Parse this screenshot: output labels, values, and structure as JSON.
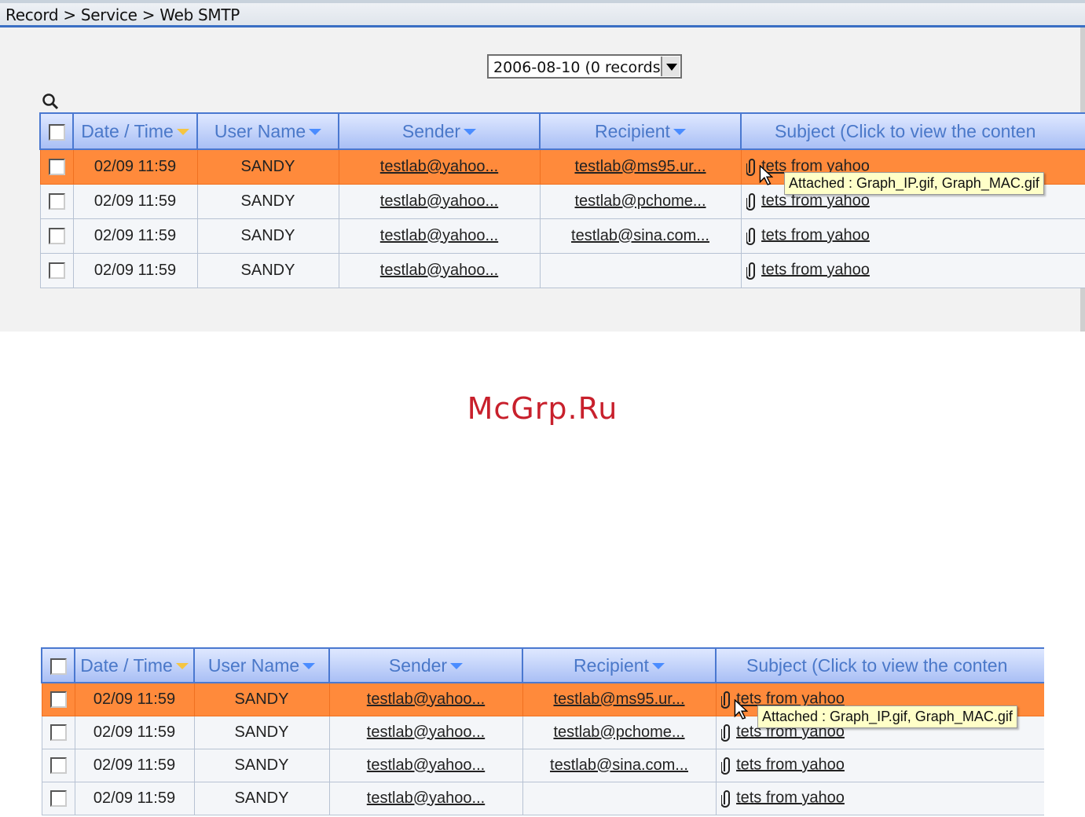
{
  "breadcrumb": "Record > Service > Web SMTP",
  "date_select": {
    "value": "2006-08-10 (0 records)"
  },
  "columns": [
    {
      "label": "Date / Time",
      "sort": "yellow"
    },
    {
      "label": "User Name",
      "sort": "blue"
    },
    {
      "label": "Sender",
      "sort": "blue"
    },
    {
      "label": "Recipient",
      "sort": "blue"
    },
    {
      "label": "Subject (Click to view the conten",
      "sort": "none"
    }
  ],
  "rows": [
    {
      "datetime": "02/09 11:59",
      "user": "SANDY",
      "sender": "testlab@yahoo...",
      "recipient": "testlab@ms95.ur...",
      "subject": "tets from yahoo",
      "selected": true
    },
    {
      "datetime": "02/09 11:59",
      "user": "SANDY",
      "sender": "testlab@yahoo...",
      "recipient": "testlab@pchome...",
      "subject": "tets from yahoo",
      "selected": false
    },
    {
      "datetime": "02/09 11:59",
      "user": "SANDY",
      "sender": "testlab@yahoo...",
      "recipient": "testlab@sina.com...",
      "subject": "tets from yahoo",
      "selected": false
    },
    {
      "datetime": "02/09 11:59",
      "user": "SANDY",
      "sender": "testlab@yahoo...",
      "recipient": "",
      "subject": "tets from yahoo",
      "selected": false
    }
  ],
  "tooltip": "Attached : Graph_IP.gif, Graph_MAC.gif",
  "watermark": "McGrp.Ru",
  "colors": {
    "selected_row": "#ff8a3b",
    "header_text": "#4a78c9",
    "header_border": "#4a78d0",
    "watermark": "#c8202c"
  },
  "icons": {
    "search": "magnifier-icon",
    "attachment": "paperclip-icon",
    "sort": "triangle-down-icon"
  }
}
